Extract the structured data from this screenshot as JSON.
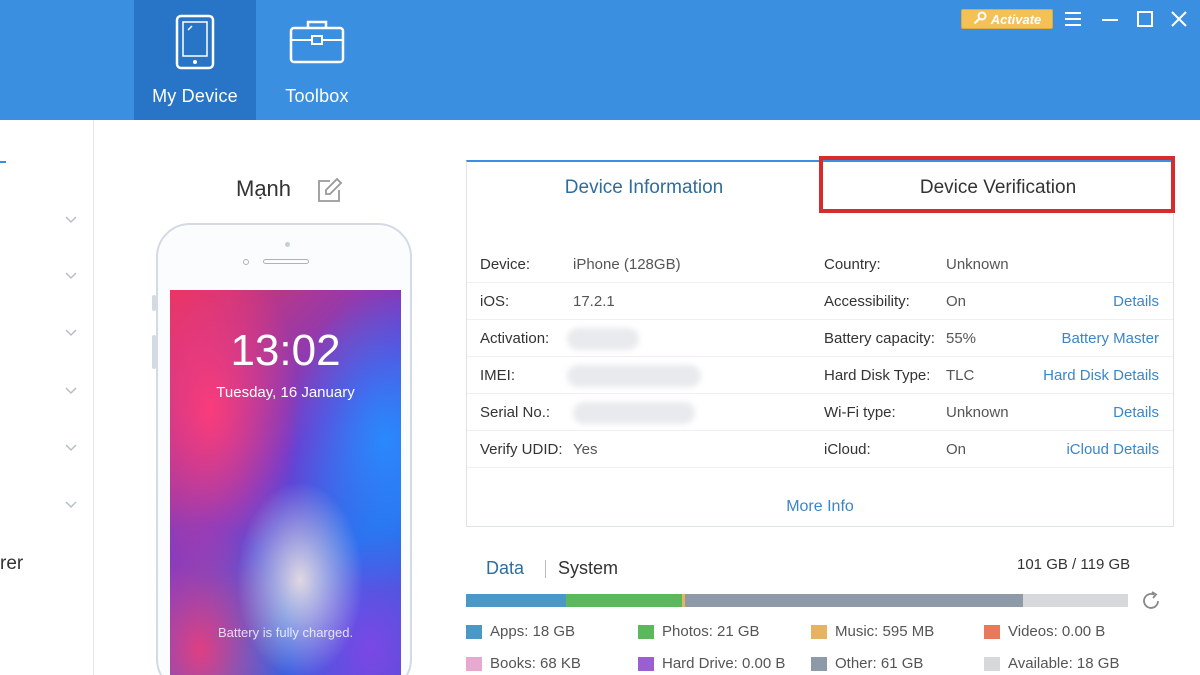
{
  "header": {
    "tabs": [
      {
        "label": "My Device",
        "icon": "tablet-icon"
      },
      {
        "label": "Toolbox",
        "icon": "toolbox-icon"
      }
    ],
    "activate_label": "Activate",
    "colors": {
      "header": "#3b8fe0",
      "active_tab": "#2874c6",
      "activate": "#f3c156"
    }
  },
  "sidebar": {
    "partial_text": "rer"
  },
  "device": {
    "name": "Mạnh",
    "lock_time": "13:02",
    "lock_date": "Tuesday, 16 January",
    "lock_battery": "Battery is fully charged."
  },
  "info": {
    "tabs": {
      "device_information": "Device Information",
      "device_verification": "Device Verification"
    },
    "rows": [
      {
        "label": "Device:",
        "value": "iPhone   (128GB)",
        "label2": "Country:",
        "value2": "Unknown",
        "link": ""
      },
      {
        "label": "iOS:",
        "value": "17.2.1",
        "label2": "Accessibility:",
        "value2": "On",
        "link": "Details"
      },
      {
        "label": "Activation:",
        "value": "",
        "label2": "Battery capacity:",
        "value2": "55%",
        "link": "Battery Master"
      },
      {
        "label": "IMEI:",
        "value": "",
        "label2": "Hard Disk Type:",
        "value2": "TLC",
        "link": "Hard Disk Details"
      },
      {
        "label": "Serial No.:",
        "value": "",
        "label2": "Wi-Fi type:",
        "value2": "Unknown",
        "link": "Details"
      },
      {
        "label": "Verify UDID:",
        "value": "Yes",
        "label2": "iCloud:",
        "value2": "On",
        "link": "iCloud Details"
      }
    ],
    "more_info": "More Info",
    "highlight_color": "#d62c2c"
  },
  "storage": {
    "tabs": {
      "data": "Data",
      "system": "System"
    },
    "total": "101 GB / 119 GB",
    "bar_segments": [
      {
        "name": "Apps",
        "fraction": 0.151,
        "color": "#4a98c8"
      },
      {
        "name": "Photos",
        "fraction": 0.176,
        "color": "#5cb85c"
      },
      {
        "name": "Music",
        "fraction": 0.004,
        "color": "#e6b460"
      },
      {
        "name": "Other",
        "fraction": 0.51,
        "color": "#8e9aa8"
      }
    ],
    "legend": [
      {
        "label": "Apps: 18 GB",
        "color": "#4a98c8"
      },
      {
        "label": "Photos: 21 GB",
        "color": "#5cb85c"
      },
      {
        "label": "Music: 595 MB",
        "color": "#e6b460"
      },
      {
        "label": "Videos: 0.00 B",
        "color": "#e8795a"
      },
      {
        "label": "Books: 68 KB",
        "color": "#e7a9cf"
      },
      {
        "label": "Hard Drive: 0.00 B",
        "color": "#9a5fd0"
      },
      {
        "label": "Other: 61 GB",
        "color": "#8e9aa8"
      },
      {
        "label": "Available: 18 GB",
        "color": "#d6d8db"
      }
    ]
  }
}
